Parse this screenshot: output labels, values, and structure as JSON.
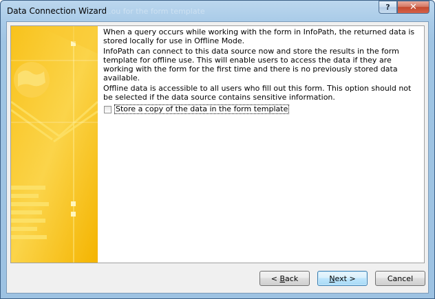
{
  "window": {
    "title": "Data Connection Wizard",
    "background_title_text": "...ou for the form template"
  },
  "caption_buttons": {
    "help": "?",
    "close": "✕"
  },
  "content": {
    "paragraphs": [
      "When a query occurs while working with the form in InfoPath, the returned data is stored locally for use in Offline Mode.",
      "InfoPath can connect to this data source now and store the results in the form template for offline use. This will enable users to access the data if they are working with the form for the first time and there is no previously stored data available.",
      "Offline data is accessible to all users who fill out this form. This option should not be selected if the data source contains sensitive information."
    ],
    "checkbox": {
      "label": "Store a copy of the data in the form template",
      "checked": false
    }
  },
  "buttons": {
    "back": {
      "prefix": "< ",
      "mnemonic": "B",
      "rest": "ack"
    },
    "next": {
      "mnemonic": "N",
      "rest": "ext >"
    },
    "cancel": "Cancel"
  },
  "colors": {
    "banner_orange": "#f7b500",
    "banner_light": "#fde870",
    "default_button_border": "#3c7fb1"
  }
}
